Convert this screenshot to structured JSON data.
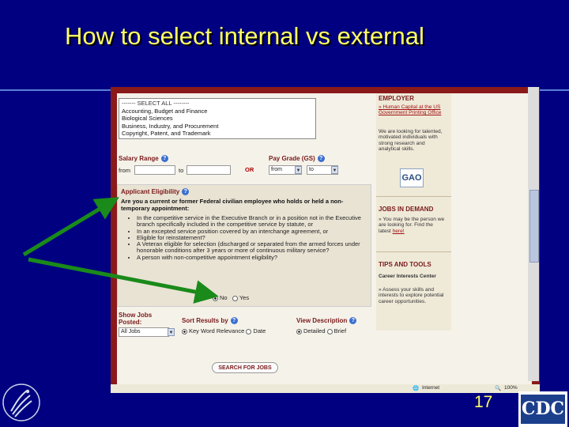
{
  "slide": {
    "title": "How to select internal vs external",
    "page_number": "17"
  },
  "categories": {
    "items": [
      "------- SELECT ALL --------",
      "Accounting, Budget and Finance",
      "Biological Sciences",
      "Business, Industry, and Procurement",
      "Copyright, Patent, and Trademark"
    ]
  },
  "salary": {
    "label": "Salary Range",
    "from": "from",
    "to": "to",
    "or": "OR"
  },
  "pay_grade": {
    "label": "Pay Grade (GS)",
    "from": "from",
    "to": "to"
  },
  "eligibility": {
    "title": "Applicant Eligibility",
    "question": "Are you a current or former Federal civilian employee who holds or held a non-temporary appointment:",
    "bullets": [
      "In the competitive service in the Executive Branch or in a position not in the Executive branch specifically included in the competitive service by statute, or",
      "In an excepted service position covered by an interchange agreement, or",
      "Eligible for reinstatement?",
      "A Veteran eligible for selection (discharged or separated from the armed forces under honorable conditions after 3 years or more of continuous military service?",
      "A person with non-competitive appointment eligibility?"
    ],
    "option_no": "No",
    "option_yes": "Yes"
  },
  "show_jobs": {
    "label": "Show Jobs Posted:",
    "value": "All Jobs"
  },
  "sort": {
    "label": "Sort Results by",
    "opt1": "Key Word Relevance",
    "opt2": "Date"
  },
  "view": {
    "label": "View Description",
    "opt1": "Detailed",
    "opt2": "Brief"
  },
  "search_button": "SEARCH FOR JOBS",
  "sidebar": {
    "employer_heading": "EMPLOYER",
    "employer_link": "» Human Capital at the US Government Printing Office",
    "employer_text": "We are looking for talented, motivated individuals with strong research and analytical skills.",
    "logo_text": "GAO",
    "jobs_heading": "JOBS IN DEMAND",
    "jobs_text": "» You may be the person we are looking for. Find the latest ",
    "jobs_link": "here!",
    "tips_heading": "TIPS AND TOOLS",
    "tips_sub": "Career Interests Center",
    "tips_text": "» Assess your skills and interests to explore potential career opportunities."
  },
  "status_bar": {
    "internet": "Internet",
    "zoom": "100%"
  },
  "logo": {
    "cdc": "CDC"
  }
}
